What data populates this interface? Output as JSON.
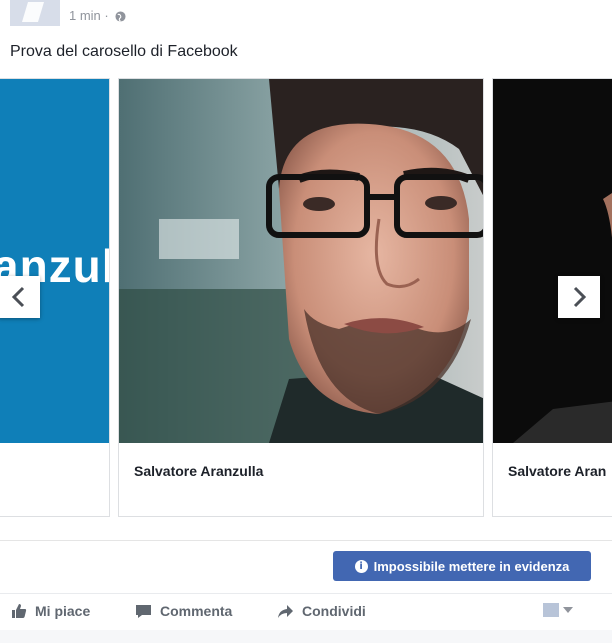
{
  "post": {
    "time": "1 min",
    "privacy_icon": "globe-icon",
    "text": "Prova del carosello di Facebook"
  },
  "carousel": {
    "cards": [
      {
        "title": "",
        "image_text": "anzul"
      },
      {
        "title": "Salvatore Aranzulla"
      },
      {
        "title": "Salvatore Aran"
      }
    ],
    "prev_icon": "chevron-left-icon",
    "next_icon": "chevron-right-icon"
  },
  "boost": {
    "icon": "info-icon",
    "label": "Impossibile mettere in evidenza",
    "color": "#4267b2"
  },
  "actions": {
    "like": "Mi piace",
    "comment": "Commenta",
    "share": "Condividi"
  }
}
